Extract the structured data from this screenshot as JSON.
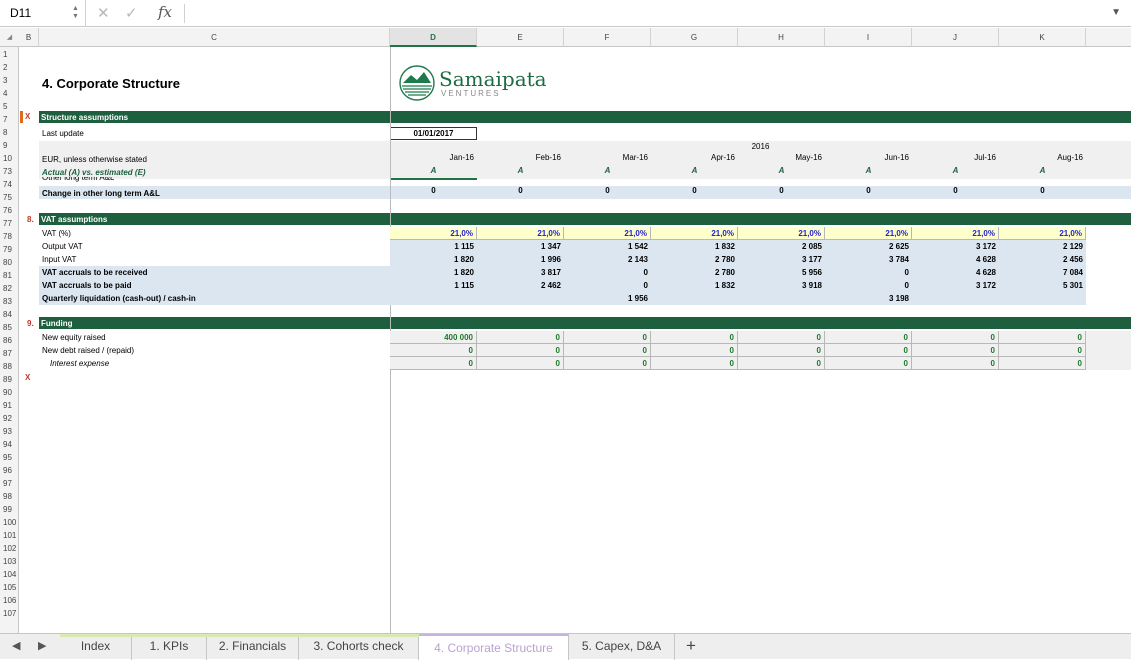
{
  "formula_bar": {
    "cell_ref": "D11",
    "fx_label": "fx",
    "cancel_icon": "x-icon",
    "confirm_icon": "check-icon"
  },
  "columns": [
    "B",
    "C",
    "D",
    "E",
    "F",
    "G",
    "H",
    "I",
    "J",
    "K"
  ],
  "row_numbers": [
    "1",
    "2",
    "3",
    "4",
    "5",
    "7",
    "8",
    "9",
    "10",
    "73",
    "74",
    "75",
    "76",
    "77",
    "78",
    "79",
    "80",
    "81",
    "82",
    "83",
    "84",
    "85",
    "86",
    "87",
    "88",
    "89",
    "90",
    "91",
    "92",
    "93",
    "94",
    "95",
    "96",
    "97",
    "98",
    "99",
    "100",
    "101",
    "102",
    "103",
    "104",
    "105",
    "106",
    "107"
  ],
  "sheet": {
    "title": "4. Corporate Structure",
    "logo_name": "Samaipata",
    "logo_sub": "VENTURES",
    "structure": {
      "header": "Structure assumptions",
      "last_update_label": "Last update",
      "last_update_value": "01/01/2017",
      "year": "2016",
      "currency_label": "EUR, unless otherwise stated",
      "actual_label": "Actual (A) vs. estimated (E)",
      "months": [
        "Jan-16",
        "Feb-16",
        "Mar-16",
        "Apr-16",
        "May-16",
        "Jun-16",
        "Jul-16",
        "Aug-16"
      ],
      "actual_flags": [
        "A",
        "A",
        "A",
        "A",
        "A",
        "A",
        "A",
        "A"
      ],
      "cut_label": "Other long term A&L",
      "change_label": "Change in other long term A&L",
      "change_values": [
        "0",
        "0",
        "0",
        "0",
        "0",
        "0",
        "0",
        "0"
      ]
    },
    "vat": {
      "num": "8.",
      "header": "VAT assumptions",
      "rows": [
        {
          "label": "VAT (%)",
          "values": [
            "21,0%",
            "21,0%",
            "21,0%",
            "21,0%",
            "21,0%",
            "21,0%",
            "21,0%",
            "21,0%"
          ]
        },
        {
          "label": "Output VAT",
          "values": [
            "1 115",
            "1 347",
            "1 542",
            "1 832",
            "2 085",
            "2 625",
            "3 172",
            "2 129"
          ]
        },
        {
          "label": "Input VAT",
          "values": [
            "1 820",
            "1 996",
            "2 143",
            "2 780",
            "3 177",
            "3 784",
            "4 628",
            "2 456"
          ]
        },
        {
          "label": "VAT accruals to be received",
          "values": [
            "1 820",
            "3 817",
            "0",
            "2 780",
            "5 956",
            "0",
            "4 628",
            "7 084"
          ]
        },
        {
          "label": "VAT accruals to be paid",
          "values": [
            "1 115",
            "2 462",
            "0",
            "1 832",
            "3 918",
            "0",
            "3 172",
            "5 301"
          ]
        },
        {
          "label": "Quarterly liquidation (cash-out) / cash-in",
          "values": [
            "",
            "",
            "1 956",
            "",
            "",
            "3 198",
            "",
            ""
          ]
        }
      ]
    },
    "funding": {
      "num": "9.",
      "header": "Funding",
      "rows": [
        {
          "label": "New equity raised",
          "values": [
            "400 000",
            "0",
            "0",
            "0",
            "0",
            "0",
            "0",
            "0"
          ]
        },
        {
          "label": "New debt raised / (repaid)",
          "values": [
            "0",
            "0",
            "0",
            "0",
            "0",
            "0",
            "0",
            "0"
          ]
        },
        {
          "label": "Interest expense",
          "values": [
            "0",
            "0",
            "0",
            "0",
            "0",
            "0",
            "0",
            "0"
          ]
        }
      ]
    },
    "x_mark": "X"
  },
  "tabs": [
    "Index",
    "1. KPIs",
    "2. Financials",
    "3. Cohorts check",
    "4. Corporate Structure",
    "5. Capex, D&A"
  ],
  "add_sheet": "+"
}
